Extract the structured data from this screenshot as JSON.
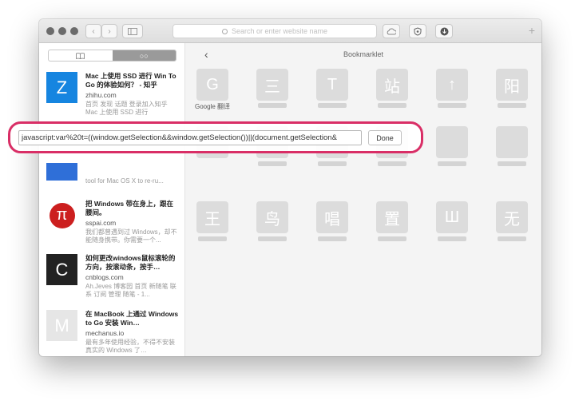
{
  "toolbar": {
    "address_placeholder": "Search or enter website name"
  },
  "sidebar": {
    "items": [
      {
        "thumb_letter": "Z",
        "thumb_color": "#1685e0",
        "title": "Mac 上使用 SSD 进行 Win To Go 的体验如何？ - 知乎",
        "domain": "zhihu.com",
        "desc": "首页 发现 话题 登录加入知乎 Mac 上使用 SSD 进行"
      },
      {
        "thumb_letter": "",
        "thumb_color": "#2f6fd8",
        "title": "",
        "domain": "",
        "desc": "tool for Mac OS X to re-ru..."
      },
      {
        "thumb_letter": "π",
        "thumb_color": "#cc1f1f",
        "title": "把 Windows 带在身上，跟在腰间。",
        "domain": "sspai.com",
        "desc": "我们都曾遇到过 Windows，却不能随身携带。你需要一个..."
      },
      {
        "thumb_letter": "C",
        "thumb_color": "#222222",
        "title": "如何更改windows鼠标滚轮的方向，按滚动条，按手…",
        "domain": "cnblogs.com",
        "desc": "Ah.Jeves 博客园 首页 新随笔 联系 订阅 管理 随笔 - 1..."
      },
      {
        "thumb_letter": "M",
        "thumb_color": "#e6e6e6",
        "title": "在 MacBook 上通过 Windows to Go 安装 Win…",
        "domain": "mechanus.io",
        "desc": "最有多年使用经验，不得不安装真实的 Windows 了…"
      }
    ]
  },
  "main": {
    "title": "Bookmarklet",
    "back_glyph": "‹",
    "tiles": [
      {
        "glyph": "G",
        "label": "Google 翻译"
      },
      {
        "glyph": "三",
        "label": ""
      },
      {
        "glyph": "T",
        "label": ""
      },
      {
        "glyph": "站",
        "label": ""
      },
      {
        "glyph": "↑",
        "label": ""
      },
      {
        "glyph": "阳",
        "label": ""
      },
      {
        "glyph": "",
        "label": ""
      },
      {
        "glyph": "",
        "label": ""
      },
      {
        "glyph": "",
        "label": ""
      },
      {
        "glyph": "",
        "label": ""
      },
      {
        "glyph": "",
        "label": ""
      },
      {
        "glyph": "",
        "label": ""
      },
      {
        "glyph": "王",
        "label": ""
      },
      {
        "glyph": "鸟",
        "label": ""
      },
      {
        "glyph": "唱",
        "label": ""
      },
      {
        "glyph": "置",
        "label": ""
      },
      {
        "glyph": "Ш",
        "label": ""
      },
      {
        "glyph": "无",
        "label": ""
      }
    ]
  },
  "edit": {
    "url_value": "javascript:var%20t=((window.getSelection&&window.getSelection())||(document.getSelection&",
    "done_label": "Done",
    "highlight_color": "#d92e66"
  }
}
